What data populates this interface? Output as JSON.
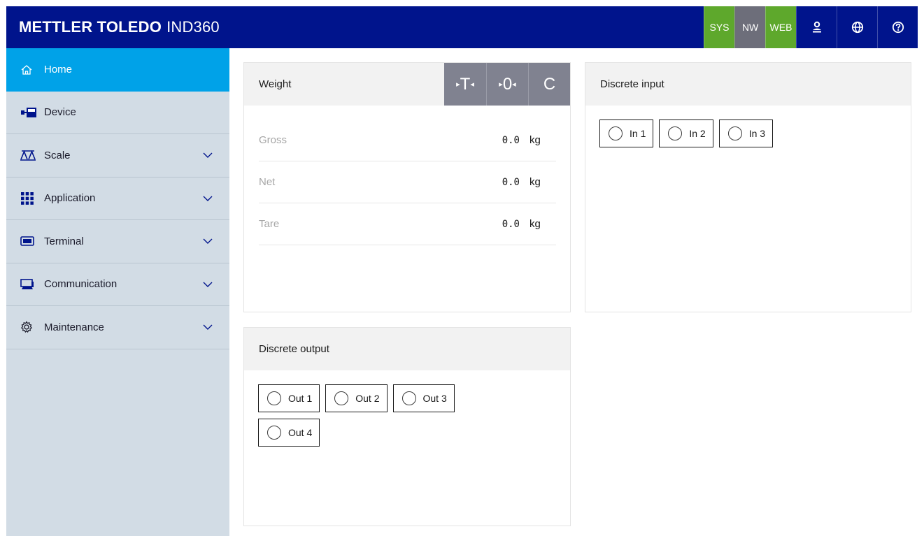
{
  "header": {
    "brand": "METTLER TOLEDO",
    "model": "IND360",
    "status": [
      {
        "label": "SYS",
        "color": "#5ea82c"
      },
      {
        "label": "NW",
        "color": "#6d6e7a"
      },
      {
        "label": "WEB",
        "color": "#5ea82c"
      }
    ],
    "icons": [
      "user-icon",
      "globe-icon",
      "help-icon"
    ]
  },
  "sidebar": {
    "items": [
      {
        "label": "Home",
        "icon": "home-icon",
        "active": true,
        "expandable": false
      },
      {
        "label": "Device",
        "icon": "device-icon",
        "active": false,
        "expandable": false
      },
      {
        "label": "Scale",
        "icon": "scale-icon",
        "active": false,
        "expandable": true
      },
      {
        "label": "Application",
        "icon": "grid-icon",
        "active": false,
        "expandable": true
      },
      {
        "label": "Terminal",
        "icon": "terminal-icon",
        "active": false,
        "expandable": true
      },
      {
        "label": "Communication",
        "icon": "communication-icon",
        "active": false,
        "expandable": true
      },
      {
        "label": "Maintenance",
        "icon": "gear-icon",
        "active": false,
        "expandable": true
      }
    ]
  },
  "weight": {
    "title": "Weight",
    "keys": {
      "tare": "T",
      "zero": "0",
      "clear": "C"
    },
    "rows": [
      {
        "label": "Gross",
        "value": "0.0",
        "unit": "kg"
      },
      {
        "label": "Net",
        "value": "0.0",
        "unit": "kg"
      },
      {
        "label": "Tare",
        "value": "0.0",
        "unit": "kg"
      }
    ]
  },
  "discrete_input": {
    "title": "Discrete input",
    "items": [
      "In 1",
      "In 2",
      "In 3"
    ]
  },
  "discrete_output": {
    "title": "Discrete output",
    "items": [
      "Out 1",
      "Out 2",
      "Out 3",
      "Out 4"
    ]
  }
}
